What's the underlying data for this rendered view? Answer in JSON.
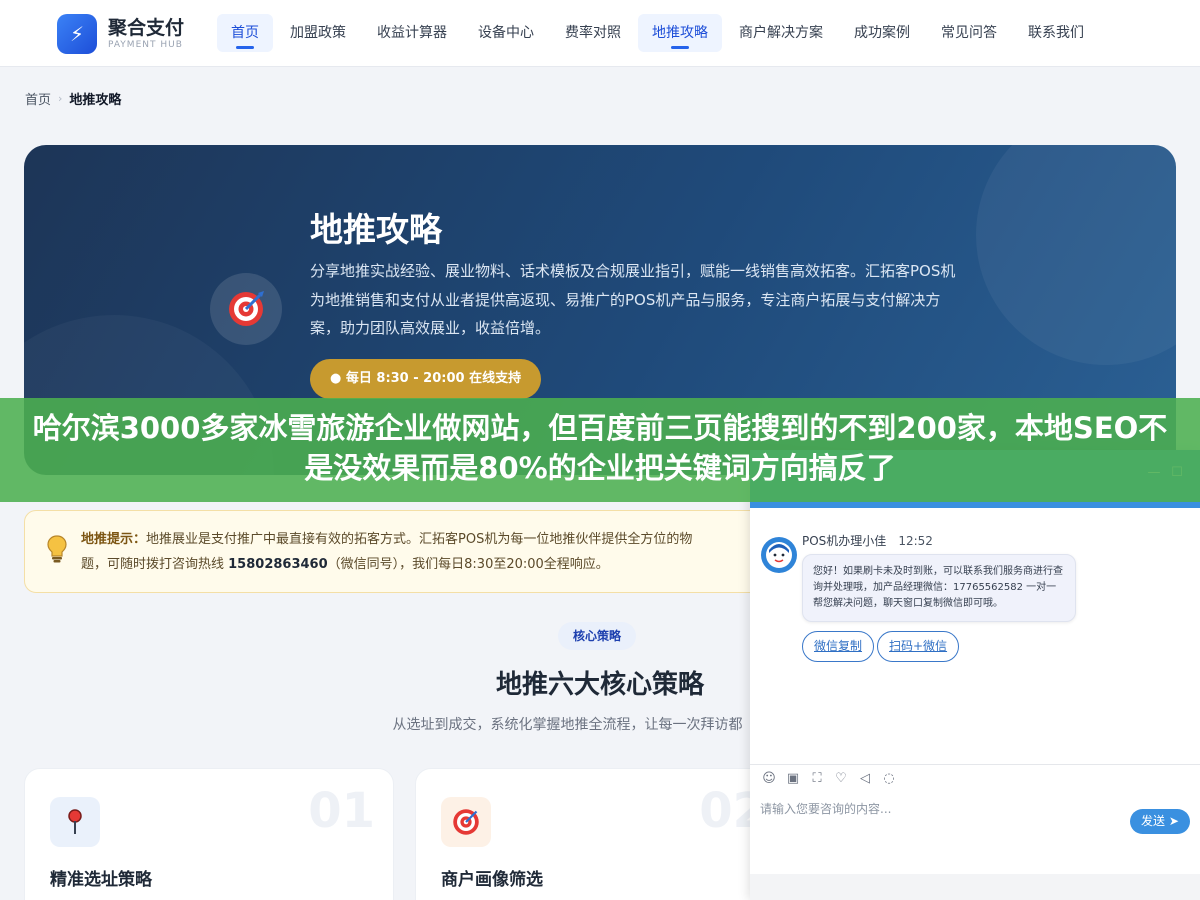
{
  "brand": {
    "name": "聚合支付",
    "sub": "PAYMENT HUB"
  },
  "nav": [
    {
      "label": "首页",
      "active": true
    },
    {
      "label": "加盟政策"
    },
    {
      "label": "收益计算器"
    },
    {
      "label": "设备中心"
    },
    {
      "label": "费率对照"
    },
    {
      "label": "地推攻略",
      "active": true
    },
    {
      "label": "商户解决方案"
    },
    {
      "label": "成功案例"
    },
    {
      "label": "常见问答"
    },
    {
      "label": "联系我们"
    }
  ],
  "breadcrumb": {
    "home": "首页",
    "current": "地推攻略"
  },
  "hero": {
    "title": "地推攻略",
    "desc": "分享地推实战经验、展业物料、话术模板及合规展业指引，赋能一线销售高效拓客。汇拓客POS机为地推销售和支付从业者提供高返现、易推广的POS机产品与服务，专注商户拓展与支付解决方案，助力团队高效展业，收益倍增。",
    "button": "● 每日 8:30 - 20:00 在线支持"
  },
  "banner": {
    "text": "哈尔滨3000多家冰雪旅游企业做网站，但百度前三页能搜到的不到200家，本地SEO不是没效果而是80%的企业把关键词方向搞反了"
  },
  "tip": {
    "label": "地推提示：",
    "text1": "地推展业是支付推广中最直接有效的拓客方式。汇拓客POS机为每一位地推伙伴提供全方位的物",
    "text2": "题，可随时拨打咨询热线 ",
    "phone": "15802863460",
    "text3": "（微信同号），我们每日8:30至20:00全程响应。"
  },
  "section": {
    "badge": "核心策略",
    "title": "地推六大核心策略",
    "subtitle": "从选址到成交，系统化掌握地推全流程，让每一次拜访都"
  },
  "cards": [
    {
      "num": "01",
      "title": "精准选址策略",
      "icon": "map-pin-icon"
    },
    {
      "num": "02",
      "title": "商户画像筛选",
      "icon": "target-icon"
    }
  ],
  "chat": {
    "agent": "POS机办理小佳",
    "time": "12:52",
    "message": "您好！如果刷卡未及时到账，可以联系我们服务商进行查询并处理哦，加产品经理微信：17765562582 一对一帮您解决问题，聊天窗口复制微信即可哦。",
    "btn_copy": "微信复制",
    "btn_scan": "扫码+微信",
    "input_placeholder": "请输入您要咨询的内容...",
    "send": "发送"
  },
  "colors": {
    "primary": "#1d4ed8",
    "hero": "#1f4a7a",
    "gold": "#c79a2f",
    "banner": "#4caf50",
    "chat": "#3a90e0"
  }
}
